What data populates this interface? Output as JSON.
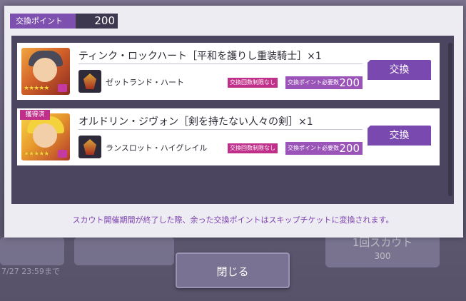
{
  "points": {
    "label": "交換ポイント",
    "value": "200"
  },
  "items": [
    {
      "name": "ティンク・ロックハート［平和を護りし重装騎士］×1",
      "acquired": false,
      "sub_name": "ゼットランド・ハート",
      "limit": "交換回数制限なし",
      "cost_label": "交換ポイント必要数",
      "cost": "200",
      "button": "交換"
    },
    {
      "name": "オルドリン・ジヴォン［剣を持たない人々の剣］×1",
      "acquired": true,
      "acquired_label": "獲得済",
      "sub_name": "ランスロット・ハイグレイル",
      "limit": "交換回数制限なし",
      "cost_label": "交換ポイント必要数",
      "cost": "200",
      "button": "交換"
    }
  ],
  "notice": "スカウト開催期間が終了した際、余った交換ポイントはスキップチケットに変換されます。",
  "close": "閉じる",
  "background": {
    "scout_button": "1回スカウト",
    "scout_cost": "300",
    "date": "7/27 23:59まで"
  },
  "colors": {
    "accent": "#7a49b0",
    "badge": "#c0308a"
  }
}
